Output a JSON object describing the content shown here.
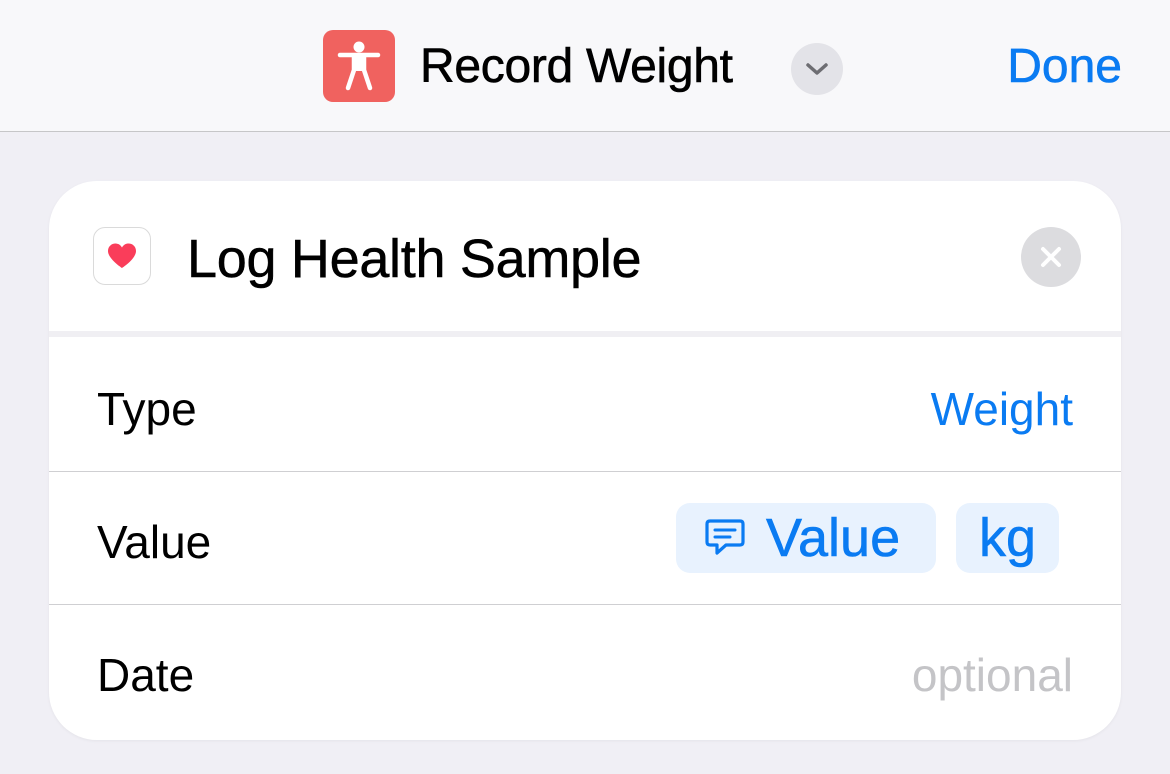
{
  "header": {
    "title": "Record Weight",
    "app_icon": "accessibility-figure-icon",
    "app_icon_color": "#f0625f",
    "menu_icon": "chevron-down-icon",
    "done_label": "Done"
  },
  "action": {
    "title": "Log Health Sample",
    "icon": "health-heart-icon",
    "remove_icon": "close-icon",
    "rows": [
      {
        "label": "Type",
        "value": "Weight"
      },
      {
        "label": "Value",
        "variable_token": "Value",
        "variable_icon": "message-bubble-icon",
        "unit": "kg"
      },
      {
        "label": "Date",
        "placeholder": "optional"
      }
    ]
  },
  "colors": {
    "accent": "#0a7bf2",
    "background": "#f0eff5",
    "card": "#ffffff",
    "token_bg": "#e8f2fe",
    "placeholder": "#c4c4c7"
  }
}
